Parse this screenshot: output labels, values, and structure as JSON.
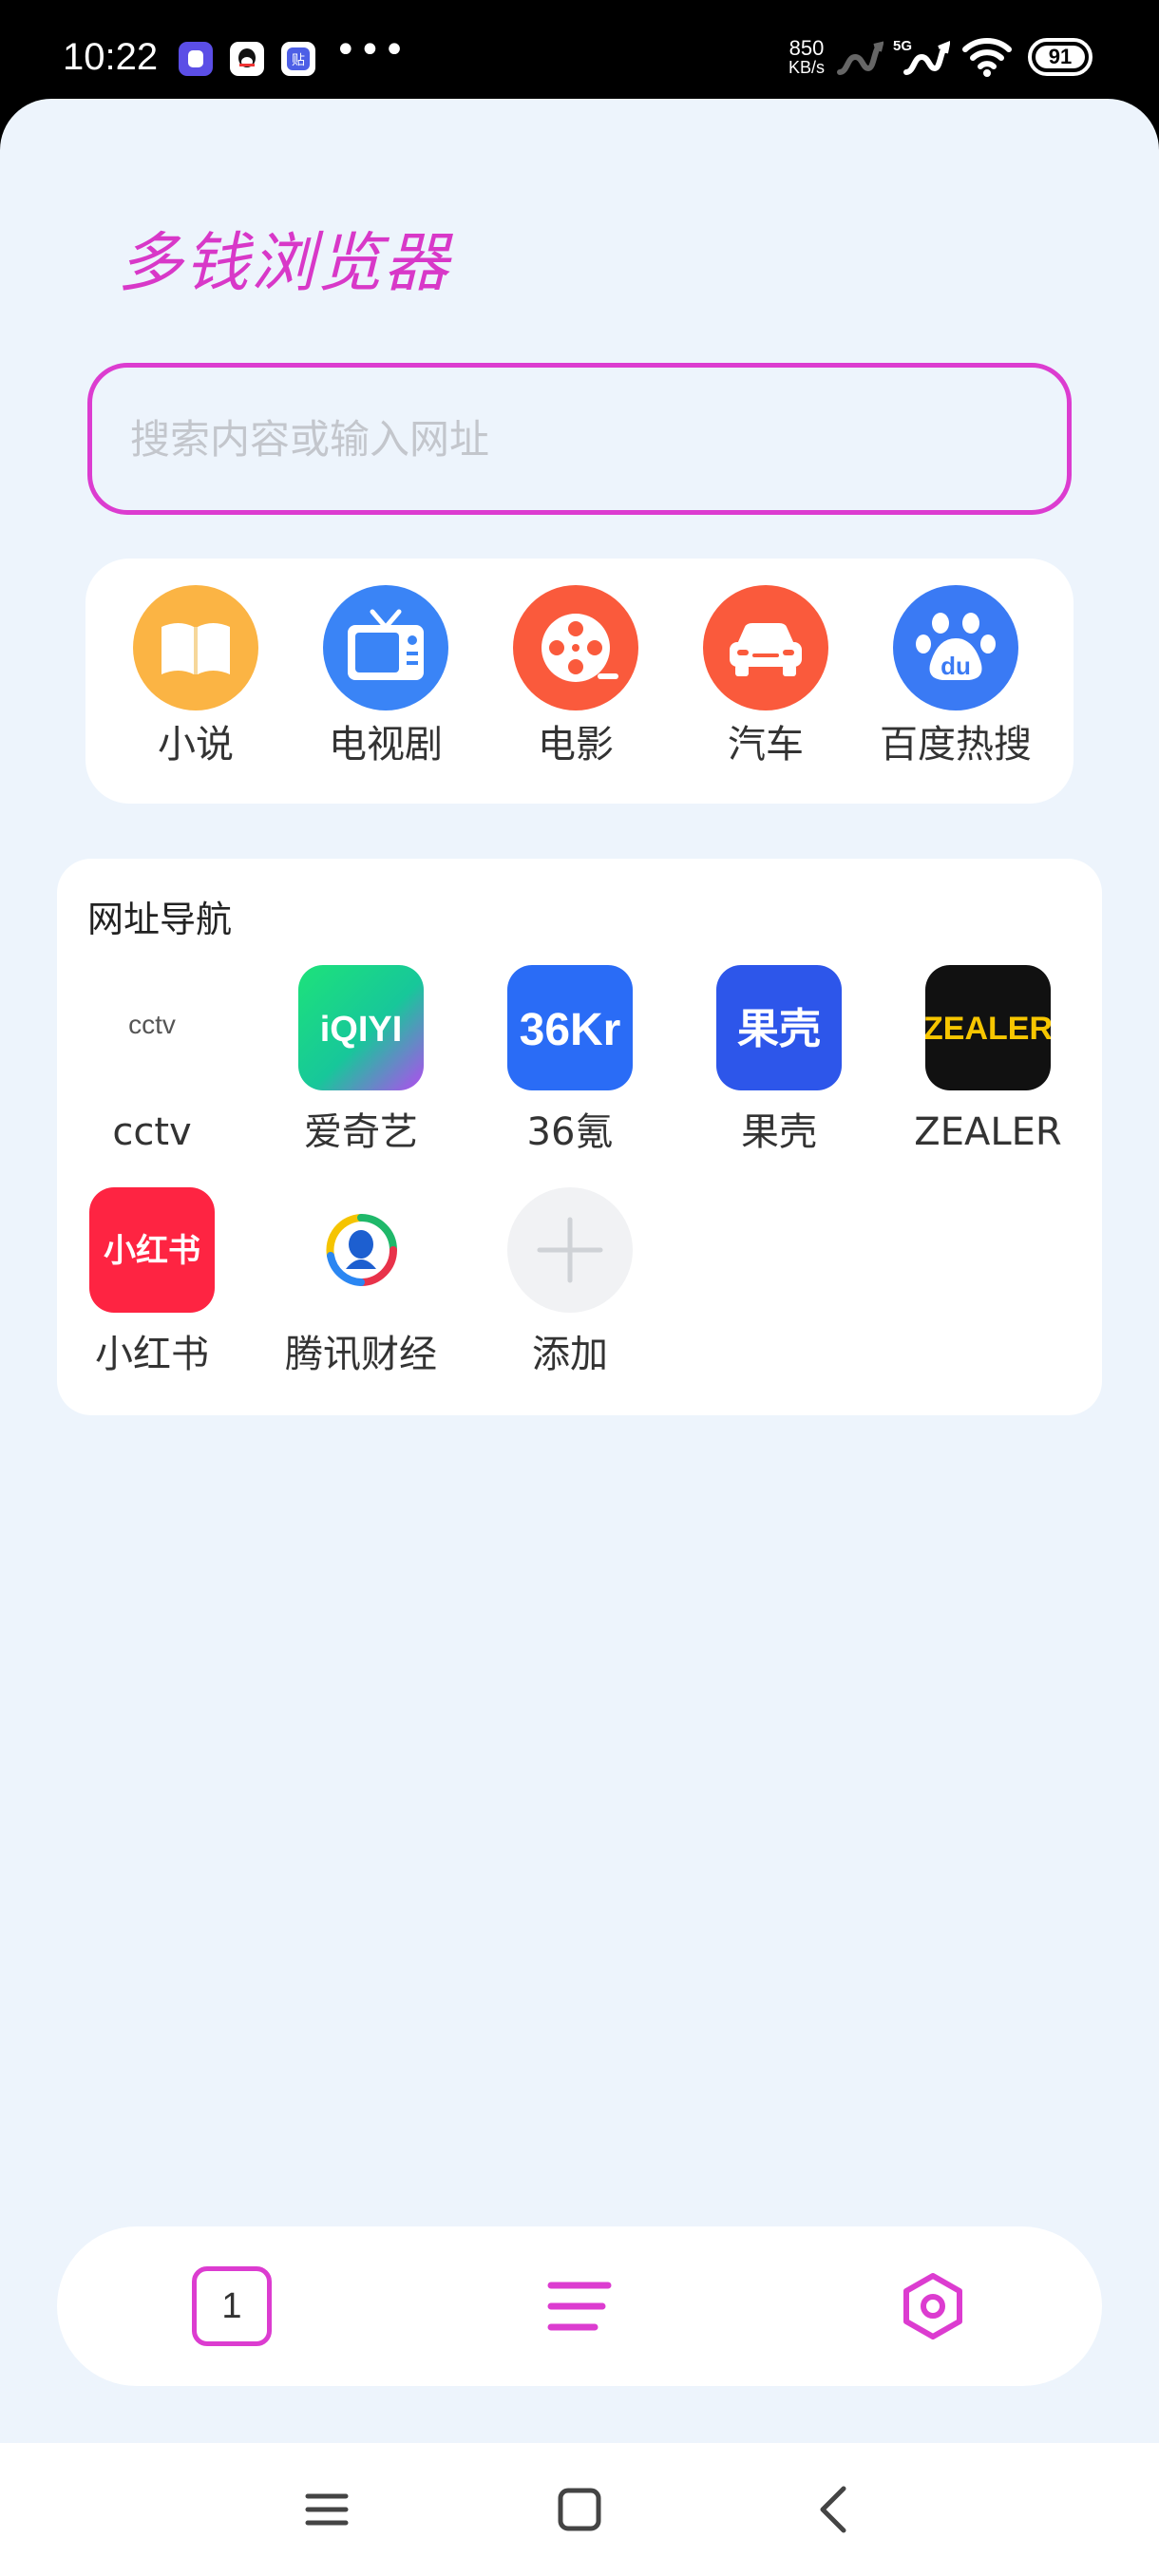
{
  "status_bar": {
    "time": "10:22",
    "app_icons": [
      "app-1-icon",
      "qq-icon",
      "tieba-icon"
    ],
    "more": "•••",
    "net_speed_value": "850",
    "net_speed_unit": "KB/s",
    "network_type": "5G",
    "battery": "91"
  },
  "brand": {
    "title": "多钱浏览器",
    "color": "#d838c8"
  },
  "search": {
    "placeholder": "搜索内容或输入网址",
    "value": ""
  },
  "quick_links": [
    {
      "label": "小说",
      "icon": "book-icon",
      "color": "#fbb444"
    },
    {
      "label": "电视剧",
      "icon": "tv-icon",
      "color": "#3a84f6"
    },
    {
      "label": "电影",
      "icon": "film-reel-icon",
      "color": "#fa5a3c"
    },
    {
      "label": "汽车",
      "icon": "car-icon",
      "color": "#fa5a3c"
    },
    {
      "label": "百度热搜",
      "icon": "baidu-paw-icon",
      "color": "#3a7af4"
    }
  ],
  "site_nav": {
    "title": "网址导航",
    "sites": [
      {
        "label": "cctv",
        "logo_text": "cctv",
        "icon": "cctv-logo"
      },
      {
        "label": "爱奇艺",
        "logo_text": "iQIYI",
        "icon": "iqiyi-logo"
      },
      {
        "label": "36氪",
        "logo_text": "36Kr",
        "icon": "36kr-logo"
      },
      {
        "label": "果壳",
        "logo_text": "果壳",
        "icon": "guokr-logo"
      },
      {
        "label": "ZEALER",
        "logo_text": "ZEALER",
        "icon": "zealer-logo"
      },
      {
        "label": "小红书",
        "logo_text": "小红书",
        "icon": "xiaohongshu-logo"
      },
      {
        "label": "腾讯财经",
        "logo_text": "",
        "icon": "tencent-finance-logo"
      },
      {
        "label": "添加",
        "logo_text": "",
        "icon": "plus-icon"
      }
    ]
  },
  "bottom_bar": {
    "tab_count": "1",
    "accent": "#dc3cd0"
  }
}
